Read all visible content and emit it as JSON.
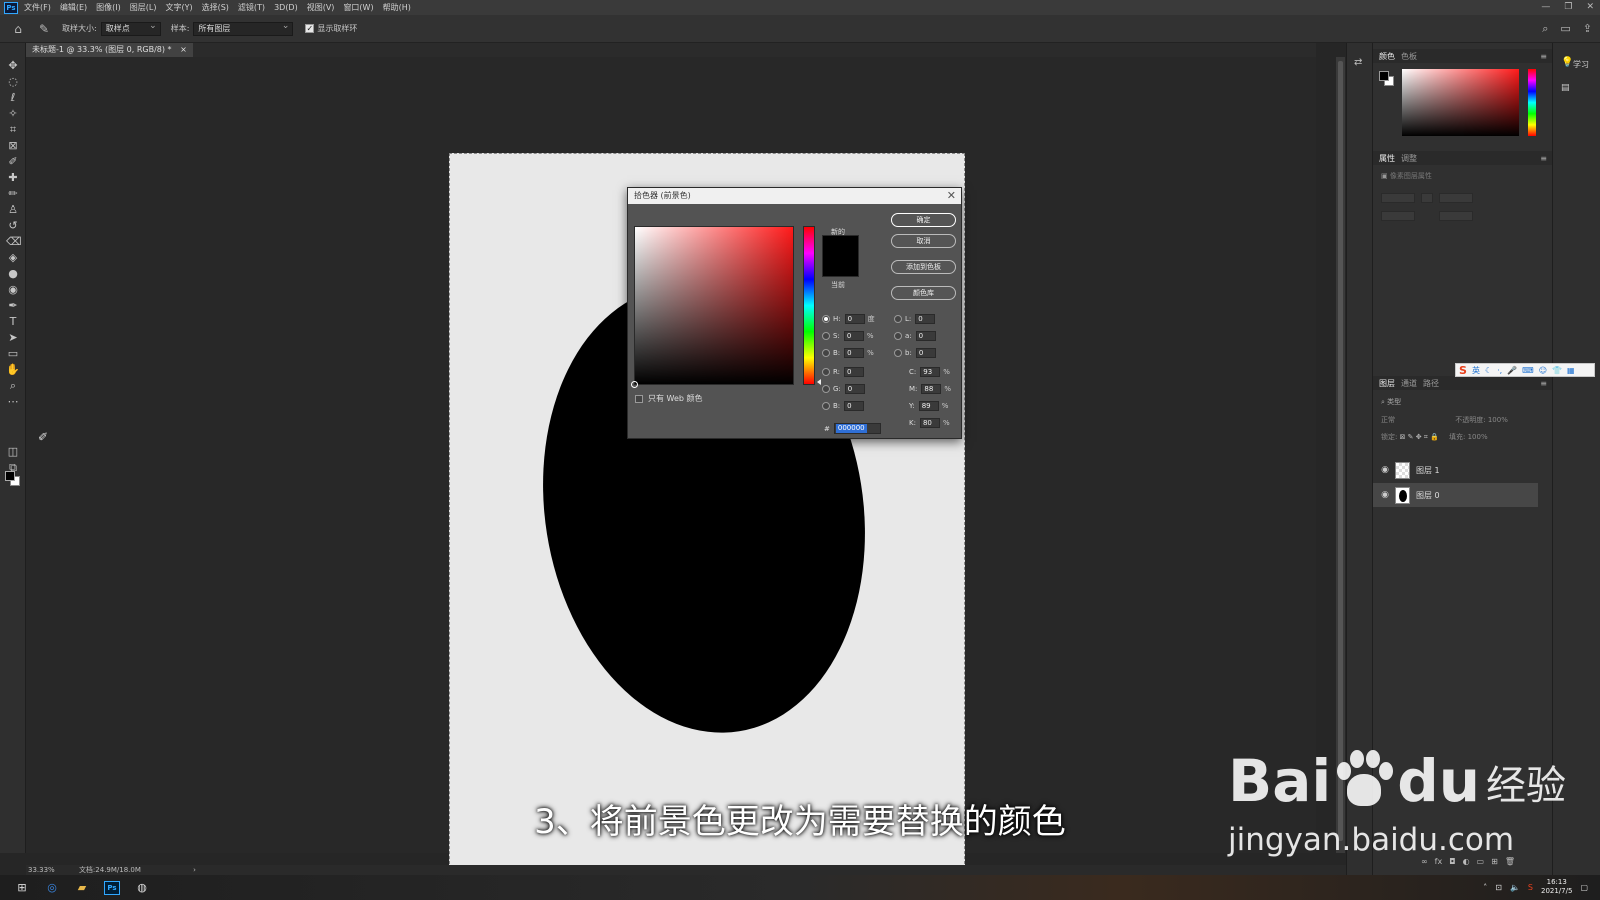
{
  "app": {
    "logo_text": "Ps",
    "menu": [
      "文件(F)",
      "编辑(E)",
      "图像(I)",
      "图层(L)",
      "文字(Y)",
      "选择(S)",
      "滤镜(T)",
      "3D(D)",
      "视图(V)",
      "窗口(W)",
      "帮助(H)"
    ],
    "window_controls": [
      "—",
      "❐",
      "✕"
    ]
  },
  "options_bar": {
    "sample_size_label": "取样大小:",
    "sample_size_value": "取样点",
    "sample_label": "样本:",
    "sample_value": "所有图层",
    "show_ring_label": "显示取样环",
    "show_ring_checked": true
  },
  "document": {
    "tab_label": "未标题-1 @ 33.3% (图层 0, RGB/8) *",
    "close_glyph": "×",
    "zoom": "33.33%",
    "doc_size": "文档:24.9M/18.0M"
  },
  "color_picker": {
    "title": "拾色器 (前景色)",
    "close_glyph": "✕",
    "label_new": "新的",
    "label_current": "当前",
    "new_color": "#000000",
    "current_color": "#000000",
    "buttons": {
      "ok": "确定",
      "cancel": "取消",
      "add_to_swatches": "添加到色板",
      "color_libraries": "颜色库"
    },
    "fields": {
      "H": {
        "label": "H:",
        "value": "0",
        "unit": "度"
      },
      "S": {
        "label": "S:",
        "value": "0",
        "unit": "%"
      },
      "B": {
        "label": "B:",
        "value": "0",
        "unit": "%"
      },
      "R": {
        "label": "R:",
        "value": "0"
      },
      "G": {
        "label": "G:",
        "value": "0"
      },
      "Bl": {
        "label": "B:",
        "value": "0"
      },
      "L": {
        "label": "L:",
        "value": "0"
      },
      "a": {
        "label": "a:",
        "value": "0"
      },
      "b": {
        "label": "b:",
        "value": "0"
      },
      "C": {
        "label": "C:",
        "value": "93",
        "unit": "%"
      },
      "M": {
        "label": "M:",
        "value": "88",
        "unit": "%"
      },
      "Y": {
        "label": "Y:",
        "value": "89",
        "unit": "%"
      },
      "K": {
        "label": "K:",
        "value": "80",
        "unit": "%"
      }
    },
    "hex_label": "#",
    "hex_value": "000000",
    "web_only_label": "只有 Web 颜色"
  },
  "panels": {
    "color_tabs": [
      "颜色",
      "色板"
    ],
    "properties_tabs": [
      "属性",
      "调整"
    ],
    "properties_subtitle": "像素图层属性",
    "layers_tabs": [
      "图层",
      "通道",
      "路径"
    ],
    "layers_filter": "类型",
    "blend_mode": "正常",
    "opacity_label": "不透明度:",
    "opacity_value": "100%",
    "lock_label": "锁定:",
    "fill_label": "填充:",
    "fill_value": "100%",
    "layers": [
      {
        "name": "图层 1",
        "selected": false
      },
      {
        "name": "图层 0",
        "selected": true
      }
    ],
    "learn_label": "学习"
  },
  "ime": {
    "logo": "S",
    "lang": "英"
  },
  "subtitle": "3、将前景色更改为需要替换的颜色",
  "watermark": {
    "brand_left": "Bai",
    "brand_right": "du",
    "brand_cn": "经验",
    "url": "jingyan.baidu.com"
  },
  "taskbar": {
    "time": "16:13",
    "date": "2021/7/5",
    "ps_label": "Ps"
  }
}
